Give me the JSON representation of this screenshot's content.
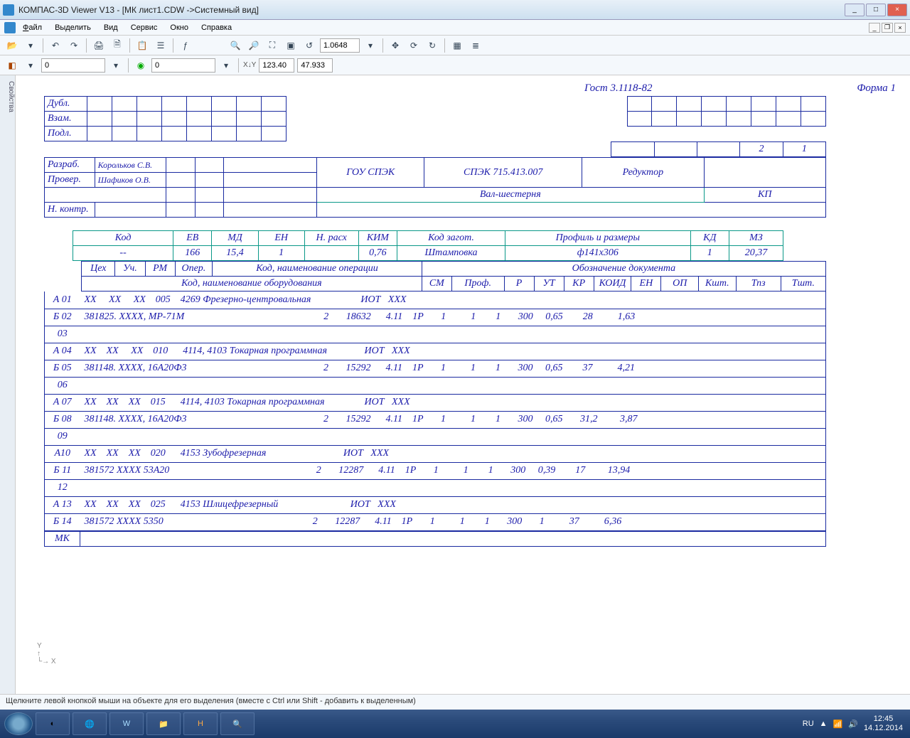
{
  "window": {
    "title": "КОМПАС-3D Viewer V13 - [МК лист1.CDW ->Системный вид]",
    "minimize": "_",
    "maximize": "□",
    "close": "×"
  },
  "menu": {
    "file": "Файл",
    "select": "Выделить",
    "view": "Вид",
    "service": "Сервис",
    "window": "Окно",
    "help": "Справка"
  },
  "tb2": {
    "zoom": "1.0648",
    "x": "123.40",
    "y": "47.933",
    "layer": "0",
    "layer2": "0"
  },
  "sidepanel": "Свойства",
  "doc": {
    "gost": "Гост 3.1118-82",
    "form": "Форма 1",
    "dubl": "Дубл.",
    "vzam": "Взам.",
    "podl": "Подл.",
    "page_cur": "2",
    "page_tot": "1",
    "razrab": "Разраб.",
    "razrab_name": "Корольков С.В.",
    "prover": "Провер.",
    "prover_name": "Шафиков О.В.",
    "org": "ГОУ СПЭК",
    "code": "СПЭК 715.413.007",
    "product": "Редуктор",
    "nkontr": "Н. контр.",
    "part": "Вал-шестерня",
    "kp": "КП",
    "hdr": {
      "kod": "Код",
      "ev": "ЕВ",
      "md": "МД",
      "en": "ЕН",
      "nrash": "Н. расх",
      "kim": "КИМ",
      "kodzag": "Код загот.",
      "profil": "Профиль и размеры",
      "kd": "КД",
      "mz": "МЗ"
    },
    "val": {
      "kod": "--",
      "ev": "166",
      "md": "15,4",
      "en": "1",
      "nrash": "",
      "kim": "0,76",
      "kodzag": "Штамповка",
      "profil": "ф141х306",
      "kd": "1",
      "mz": "20,37"
    },
    "sub1": {
      "ceh": "Цех",
      "uch": "Уч.",
      "rm": "РМ",
      "oper": "Опер.",
      "kodop": "Код, наименование операции",
      "obozn": "Обозначение документа"
    },
    "sub2": {
      "kodob": "Код, наименование оборудования",
      "sm": "СМ",
      "prof": "Проф.",
      "r": "Р",
      "ut": "УТ",
      "kr": "КР",
      "koid": "КОИД",
      "en": "ЕН",
      "op": "ОП",
      "ksht": "Кшт.",
      "tpz": "Тпз",
      "tsht": "Тшт."
    },
    "rows": [
      {
        "n": "А 01",
        "t": "ХХ     ХХ     ХХ    005    4269 Фрезерно-центровальная                    ИОТ   ХХХ"
      },
      {
        "n": "Б 02",
        "t": "381825. ХХХХ, МР-71М                                                        2       18632      4.11    1Р       1          1        1       300     0,65        28          1,63"
      },
      {
        "n": "03",
        "t": ""
      },
      {
        "n": "А 04",
        "t": "ХХ    ХХ     ХХ    010      4114, 4103 Токарная программная               ИОТ   ХХХ"
      },
      {
        "n": "Б 05",
        "t": "381148. ХХХХ, 16А20Ф3                                                       2       15292      4.11    1Р       1          1        1       300     0,65        37          4,21"
      },
      {
        "n": "06",
        "t": ""
      },
      {
        "n": "А 07",
        "t": "ХХ    ХХ    ХХ    015      4114, 4103 Токарная программная                ИОТ   ХХХ"
      },
      {
        "n": "Б 08",
        "t": "381148. ХХХХ, 16А20Ф3                                                       2       15292      4.11    1Р       1          1        1       300     0,65       31,2         3,87"
      },
      {
        "n": "09",
        "t": ""
      },
      {
        "n": "А10",
        "t": "ХХ    ХХ    ХХ    020      4153 Зубофрезерная                               ИОТ   ХХХ"
      },
      {
        "n": "Б 11",
        "t": "381572 ХХХХ 53А20                                                           2       12287      4.11    1Р       1          1        1       300     0,39        17         13,94"
      },
      {
        "n": "12",
        "t": ""
      },
      {
        "n": "А 13",
        "t": "ХХ    ХХ    ХХ    025      4153 Шлицефрезерный                             ИОТ   ХХХ"
      },
      {
        "n": "Б 14",
        "t": "381572 ХХХХ 5350                                                            2       12287      4.11    1Р       1          1        1       300       1          37          6,36"
      }
    ],
    "mk": "МК"
  },
  "status": "Щелкните левой кнопкой мыши на объекте для его выделения (вместе с Ctrl или Shift - добавить к выделенным)",
  "tray": {
    "lang": "RU",
    "time": "12:45",
    "date": "14.12.2014"
  }
}
